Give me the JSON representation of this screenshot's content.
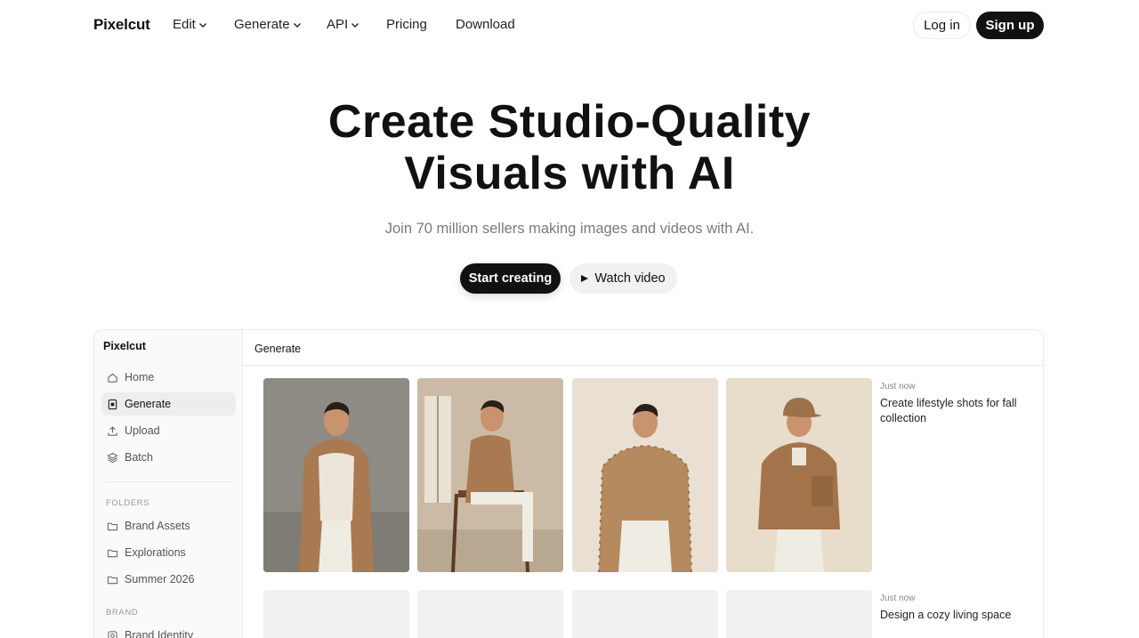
{
  "nav": {
    "logo": "Pixelcut",
    "items": [
      {
        "label": "Edit",
        "dropdown": true
      },
      {
        "label": "Generate",
        "dropdown": true
      },
      {
        "label": "API",
        "dropdown": true
      },
      {
        "label": "Pricing",
        "dropdown": false
      },
      {
        "label": "Download",
        "dropdown": false
      }
    ],
    "login": "Log in",
    "signup": "Sign up"
  },
  "hero": {
    "title_line1": "Create Studio-Quality",
    "title_line2": "Visuals with AI",
    "subtitle": "Join 70 million sellers making images and videos with AI.",
    "cta_primary": "Start creating",
    "cta_secondary": "Watch video"
  },
  "app": {
    "brand": "Pixelcut",
    "sidebar": {
      "items": [
        {
          "label": "Home",
          "icon": "home-icon",
          "active": false
        },
        {
          "label": "Generate",
          "icon": "generate-icon",
          "active": true
        },
        {
          "label": "Upload",
          "icon": "upload-icon",
          "active": false
        },
        {
          "label": "Batch",
          "icon": "layers-icon",
          "active": false
        }
      ],
      "folders_heading": "FOLDERS",
      "folders": [
        "Brand Assets",
        "Explorations",
        "Summer 2026"
      ],
      "brand_heading": "BRAND",
      "brand_items": [
        "Brand Identity"
      ]
    },
    "main_title": "Generate",
    "rows": [
      {
        "time": "Just now",
        "prompt": "Create lifestyle shots for fall collection"
      },
      {
        "time": "Just now",
        "prompt": "Design a cozy living space"
      }
    ]
  },
  "colors": {
    "primary": "#111111",
    "muted_text": "#7a7a7a",
    "sidebar_bg": "#fafafa",
    "active_item_bg": "#ededed",
    "coat": "#a97a52",
    "sweater": "#b58a5f"
  }
}
